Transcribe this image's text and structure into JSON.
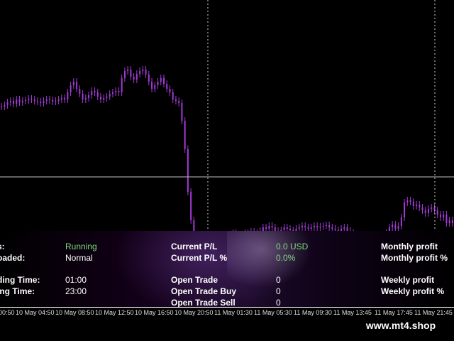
{
  "panel": {
    "rows": [
      {
        "label": "s:",
        "value": "Running",
        "value_color": "green",
        "label2": "Current P/L",
        "value2": "0.0 USD",
        "value2_color": "green",
        "label3": "Monthly profit"
      },
      {
        "label": "oaded:",
        "value": "Normal",
        "value_color": "white",
        "label2": "Current P/L %",
        "value2": "0.0%",
        "value2_color": "green",
        "label3": "Monthly profit %"
      },
      {
        "label": "ding Time:",
        "value": "01:00",
        "value_color": "white",
        "label2": "Open Trade",
        "value2": "0",
        "value2_color": "white",
        "label3": "Weekly profit"
      },
      {
        "label": "ing Time:",
        "value": "23:00",
        "value_color": "white",
        "label2": "Open Trade Buy",
        "value2": "0",
        "value2_color": "white",
        "label3": "Weekly profit %"
      },
      {
        "label": "",
        "value": "",
        "value_color": "white",
        "label2": "Open Trade Sell",
        "value2": "0",
        "value2_color": "white",
        "label3": ""
      }
    ]
  },
  "time_axis": {
    "labels": [
      "00:50",
      "10 May 04:50",
      "10 May 08:50",
      "10 May 12:50",
      "10 May 16:50",
      "10 May 20:50",
      "11 May 01:30",
      "11 May 05:30",
      "11 May 09:30",
      "11 May 13:45",
      "11 May 17:45",
      "11 May 21:45"
    ]
  },
  "watermark": "www.mt4.shop",
  "colors": {
    "candle": "#a23ad6",
    "grid": "#bfbfbf",
    "background": "#000000",
    "positive": "#7cd97c"
  },
  "chart_data": {
    "type": "line",
    "series_style": "candlestick",
    "values": [
      80,
      78,
      74,
      72,
      76,
      70,
      74,
      72,
      71,
      69,
      70,
      72,
      73,
      75,
      72,
      70,
      71,
      73,
      72,
      70,
      68,
      70,
      60,
      50,
      45,
      55,
      62,
      70,
      68,
      64,
      58,
      60,
      66,
      70,
      68,
      66,
      62,
      60,
      58,
      60,
      40,
      30,
      28,
      38,
      42,
      34,
      30,
      28,
      35,
      45,
      55,
      50,
      45,
      40,
      48,
      55,
      60,
      70,
      72,
      75,
      100,
      140,
      200,
      240,
      260,
      270,
      285,
      290,
      292,
      294,
      286,
      280,
      270,
      268,
      265,
      262,
      264,
      258,
      262,
      266,
      262,
      258,
      260,
      256,
      258,
      262,
      255,
      250,
      252,
      248,
      250,
      255,
      258,
      254,
      250,
      252,
      254,
      256,
      252,
      250,
      248,
      250,
      252,
      250,
      248,
      250,
      249,
      248,
      247,
      250,
      252,
      254,
      256,
      252,
      250,
      255,
      258,
      262,
      264,
      260,
      262,
      268,
      272,
      266,
      264,
      262,
      266,
      270,
      258,
      250,
      246,
      252,
      248,
      236,
      215,
      212,
      214,
      220,
      218,
      222,
      226,
      230,
      224,
      222,
      226,
      232,
      236,
      232,
      244,
      240,
      244
    ],
    "hlines": [
      "level-line"
    ],
    "vlines": [
      "session-divider-1",
      "session-divider-2"
    ]
  }
}
